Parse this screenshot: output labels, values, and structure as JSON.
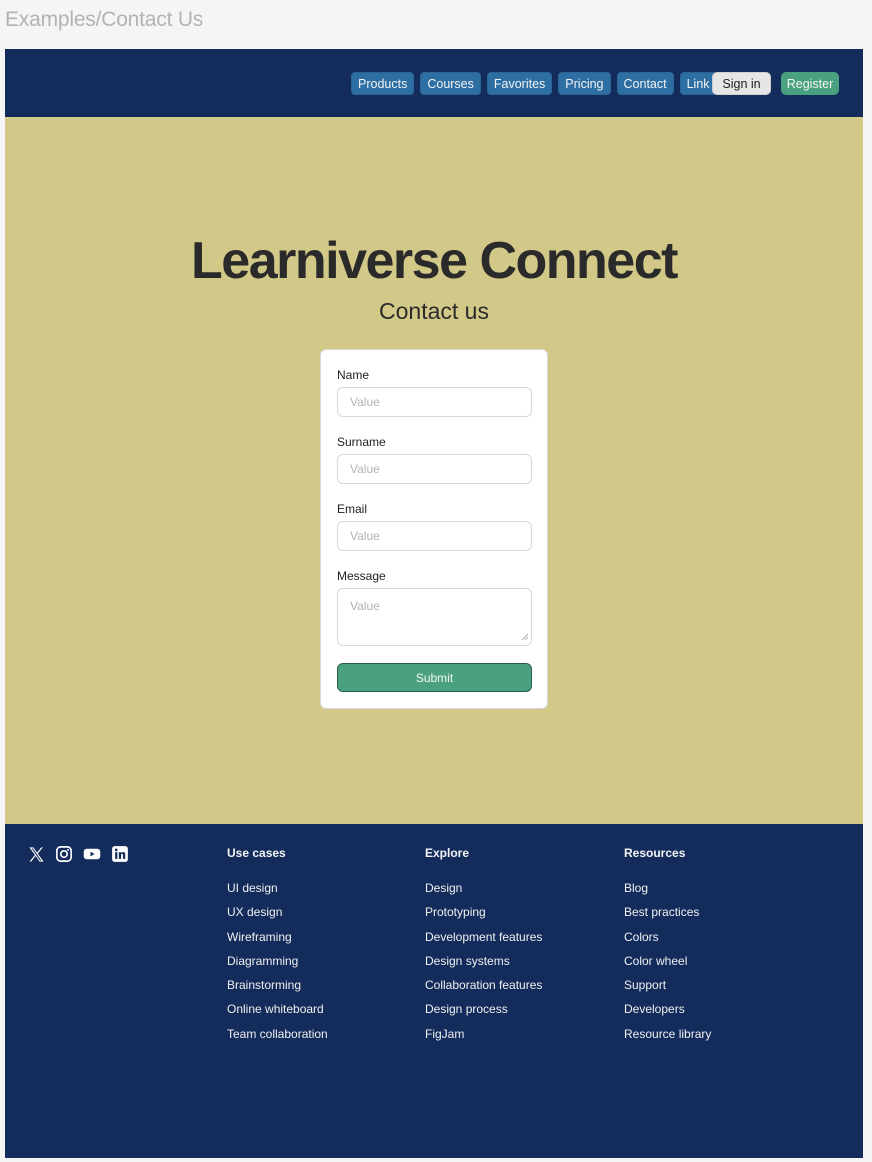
{
  "frame_title": "Examples/Contact Us",
  "colors": {
    "header_bg": "#132c5c",
    "hero_bg": "#d2c888",
    "nav_item_bg": "#2d6ea3",
    "accent_green": "#4aa17f"
  },
  "nav": {
    "items": [
      {
        "label": "Products"
      },
      {
        "label": "Courses"
      },
      {
        "label": "Favorites"
      },
      {
        "label": "Pricing"
      },
      {
        "label": "Contact"
      },
      {
        "label": "Link"
      }
    ],
    "sign_in": "Sign in",
    "register": "Register"
  },
  "hero": {
    "title": "Learniverse Connect",
    "subtitle": "Contact us"
  },
  "form": {
    "fields": [
      {
        "label": "Name",
        "placeholder": "Value"
      },
      {
        "label": "Surname",
        "placeholder": "Value"
      },
      {
        "label": "Email",
        "placeholder": "Value"
      },
      {
        "label": "Message",
        "placeholder": "Value"
      }
    ],
    "submit": "Submit"
  },
  "footer": {
    "social_icons": [
      "x-icon",
      "instagram-icon",
      "youtube-icon",
      "linkedin-icon"
    ],
    "columns": [
      {
        "heading": "Use cases",
        "links": [
          "UI design",
          "UX design",
          "Wireframing",
          "Diagramming",
          "Brainstorming",
          "Online whiteboard",
          "Team collaboration"
        ]
      },
      {
        "heading": "Explore",
        "links": [
          "Design",
          "Prototyping",
          "Development features",
          "Design systems",
          "Collaboration features",
          "Design process",
          "FigJam"
        ]
      },
      {
        "heading": "Resources",
        "links": [
          "Blog",
          "Best practices",
          "Colors",
          "Color wheel",
          "Support",
          "Developers",
          "Resource library"
        ]
      }
    ]
  }
}
